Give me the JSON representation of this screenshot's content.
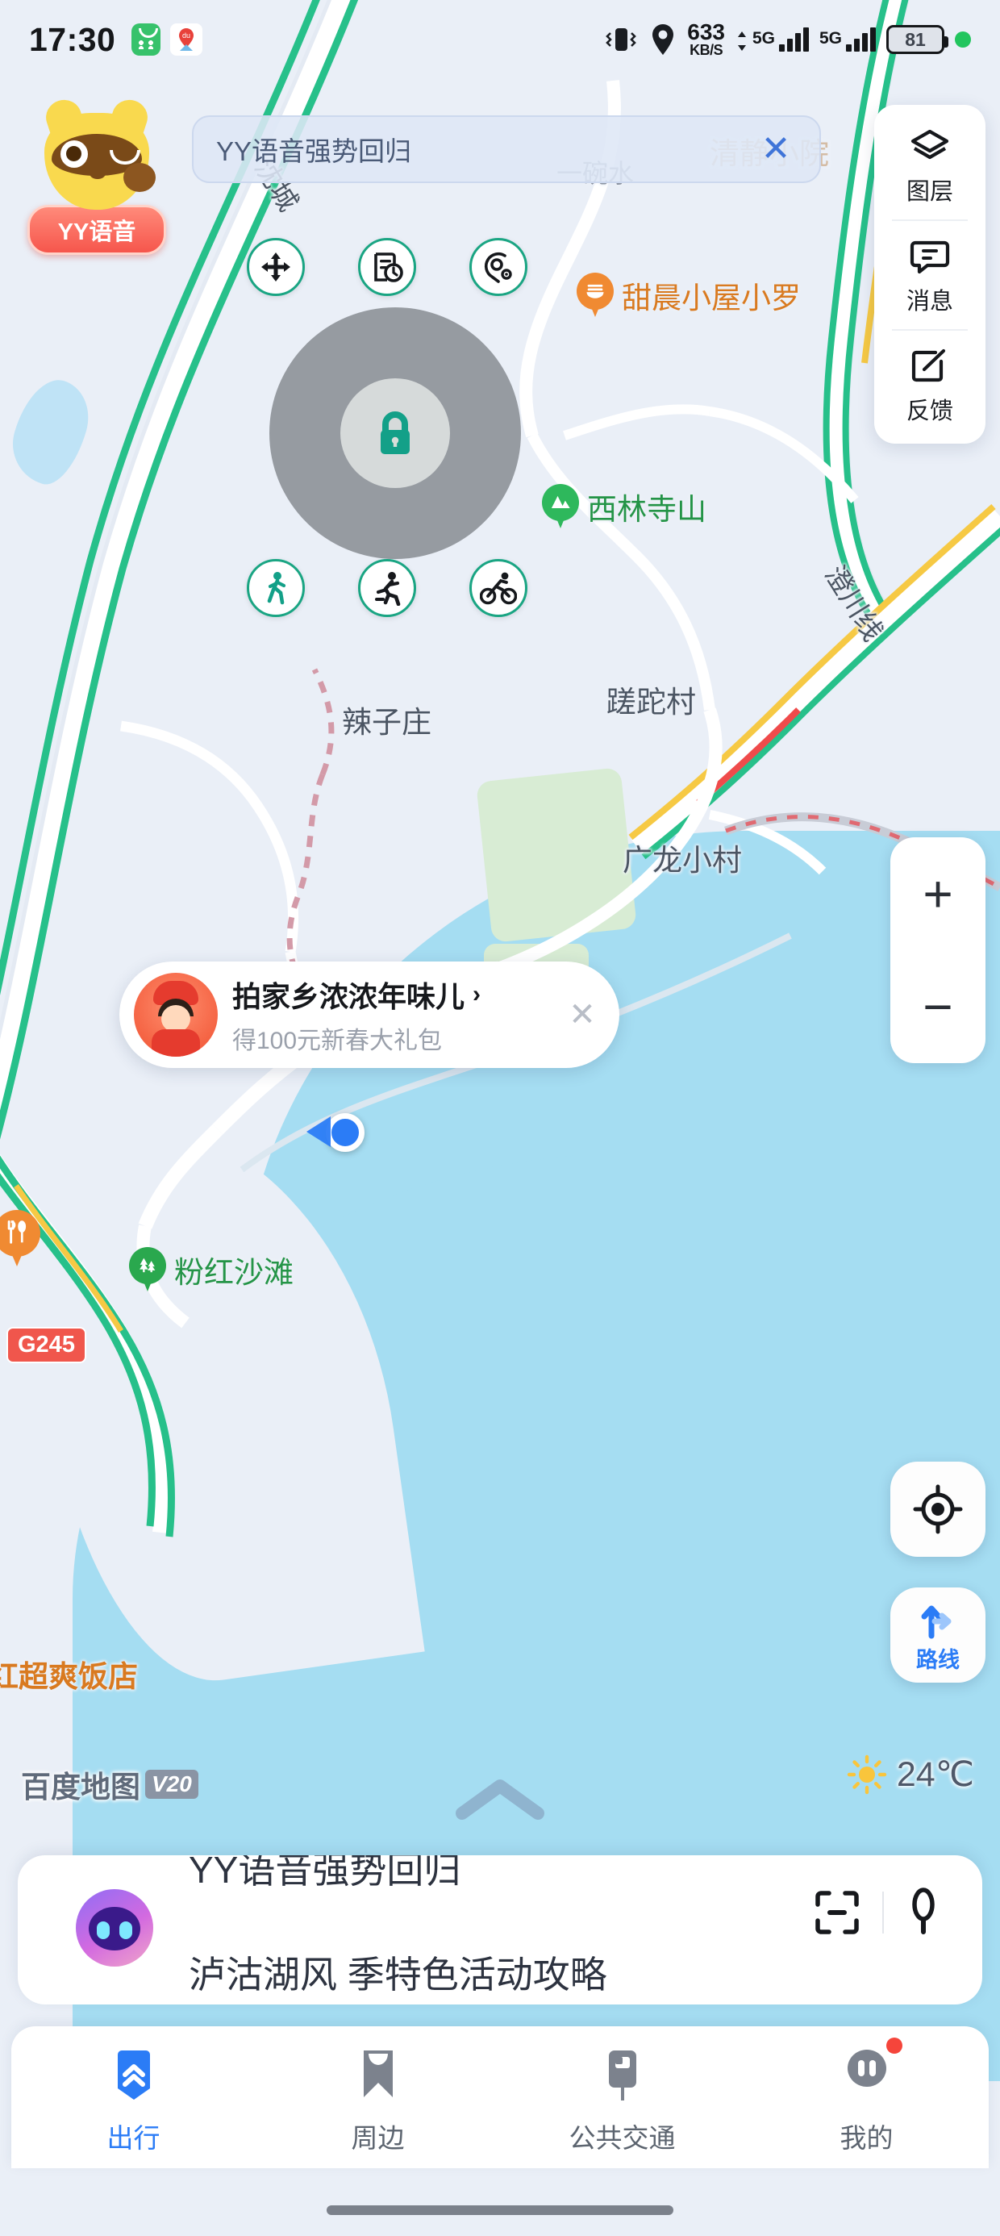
{
  "statusbar": {
    "time": "17:30",
    "network_speed": "633",
    "network_unit": "KB/S",
    "net_type_1": "5G",
    "net_type_2": "5G",
    "battery": "81"
  },
  "brand_overlay": {
    "mascot_label": "YY语音"
  },
  "top_search": {
    "text": "YY语音强势回归",
    "close": "✕"
  },
  "tool_panel": [
    {
      "label": "图层",
      "icon": "layers-icon"
    },
    {
      "label": "消息",
      "icon": "message-icon"
    },
    {
      "label": "反馈",
      "icon": "feedback-icon"
    }
  ],
  "control_cluster": {
    "center_icon": "lock-icon",
    "buttons": [
      {
        "icon": "move-arrows-icon"
      },
      {
        "icon": "record-history-icon"
      },
      {
        "icon": "location-radar-icon"
      },
      {
        "icon": "walking-icon"
      },
      {
        "icon": "running-icon"
      },
      {
        "icon": "cycling-icon"
      }
    ]
  },
  "promo_card": {
    "title": "拍家乡浓浓年味儿",
    "chevron": "›",
    "subtitle": "得100元新春大礼包",
    "close": "✕"
  },
  "map_controls": {
    "zoom_in": "+",
    "zoom_out": "−",
    "locate_icon": "crosshair-icon",
    "route_label": "路线"
  },
  "map_labels": {
    "roads": [
      {
        "name": "沈城",
        "rotated": true
      },
      {
        "name": "澄川线",
        "rotated": true
      }
    ],
    "places": [
      {
        "name": "一碗水"
      },
      {
        "name": "清静小院"
      },
      {
        "name": "辣子庄"
      },
      {
        "name": "蹉跎村"
      },
      {
        "name": "广龙小村"
      }
    ],
    "pois": [
      {
        "name": "甜晨小屋小罗",
        "type": "restaurant",
        "color": "#d97a20"
      },
      {
        "name": "西林寺山",
        "type": "mountain",
        "color": "#249447"
      },
      {
        "name": "粉红沙滩",
        "type": "park",
        "color": "#249447"
      },
      {
        "name": "红超爽饭店",
        "type": "restaurant",
        "color": "#d97a20"
      }
    ],
    "highway_shield": "G245"
  },
  "watermark": {
    "brand": "百度地图",
    "version": "V20"
  },
  "weather": {
    "icon": "sun-icon",
    "temperature": "24℃"
  },
  "bottom_sheet": {
    "ghost_line_1": "YY语音强势回归",
    "ghost_line_2": "泸沽湖风 季特色活动攻略",
    "scan_icon": "scan-icon",
    "mic_icon": "microphone-icon"
  },
  "tabbar": [
    {
      "label": "出行",
      "icon": "travel-icon",
      "active": true,
      "badge": false
    },
    {
      "label": "周边",
      "icon": "nearby-icon",
      "active": false,
      "badge": false
    },
    {
      "label": "公共交通",
      "icon": "transit-icon",
      "active": false,
      "badge": false
    },
    {
      "label": "我的",
      "icon": "profile-icon",
      "active": false,
      "badge": true
    }
  ],
  "colors": {
    "accent_blue": "#2b7cf6",
    "map_green": "#27c08a",
    "lake_blue": "#a5ddf2",
    "teal": "#1aa583",
    "poi_orange": "#f08a32",
    "badge_red": "#f5453b"
  }
}
